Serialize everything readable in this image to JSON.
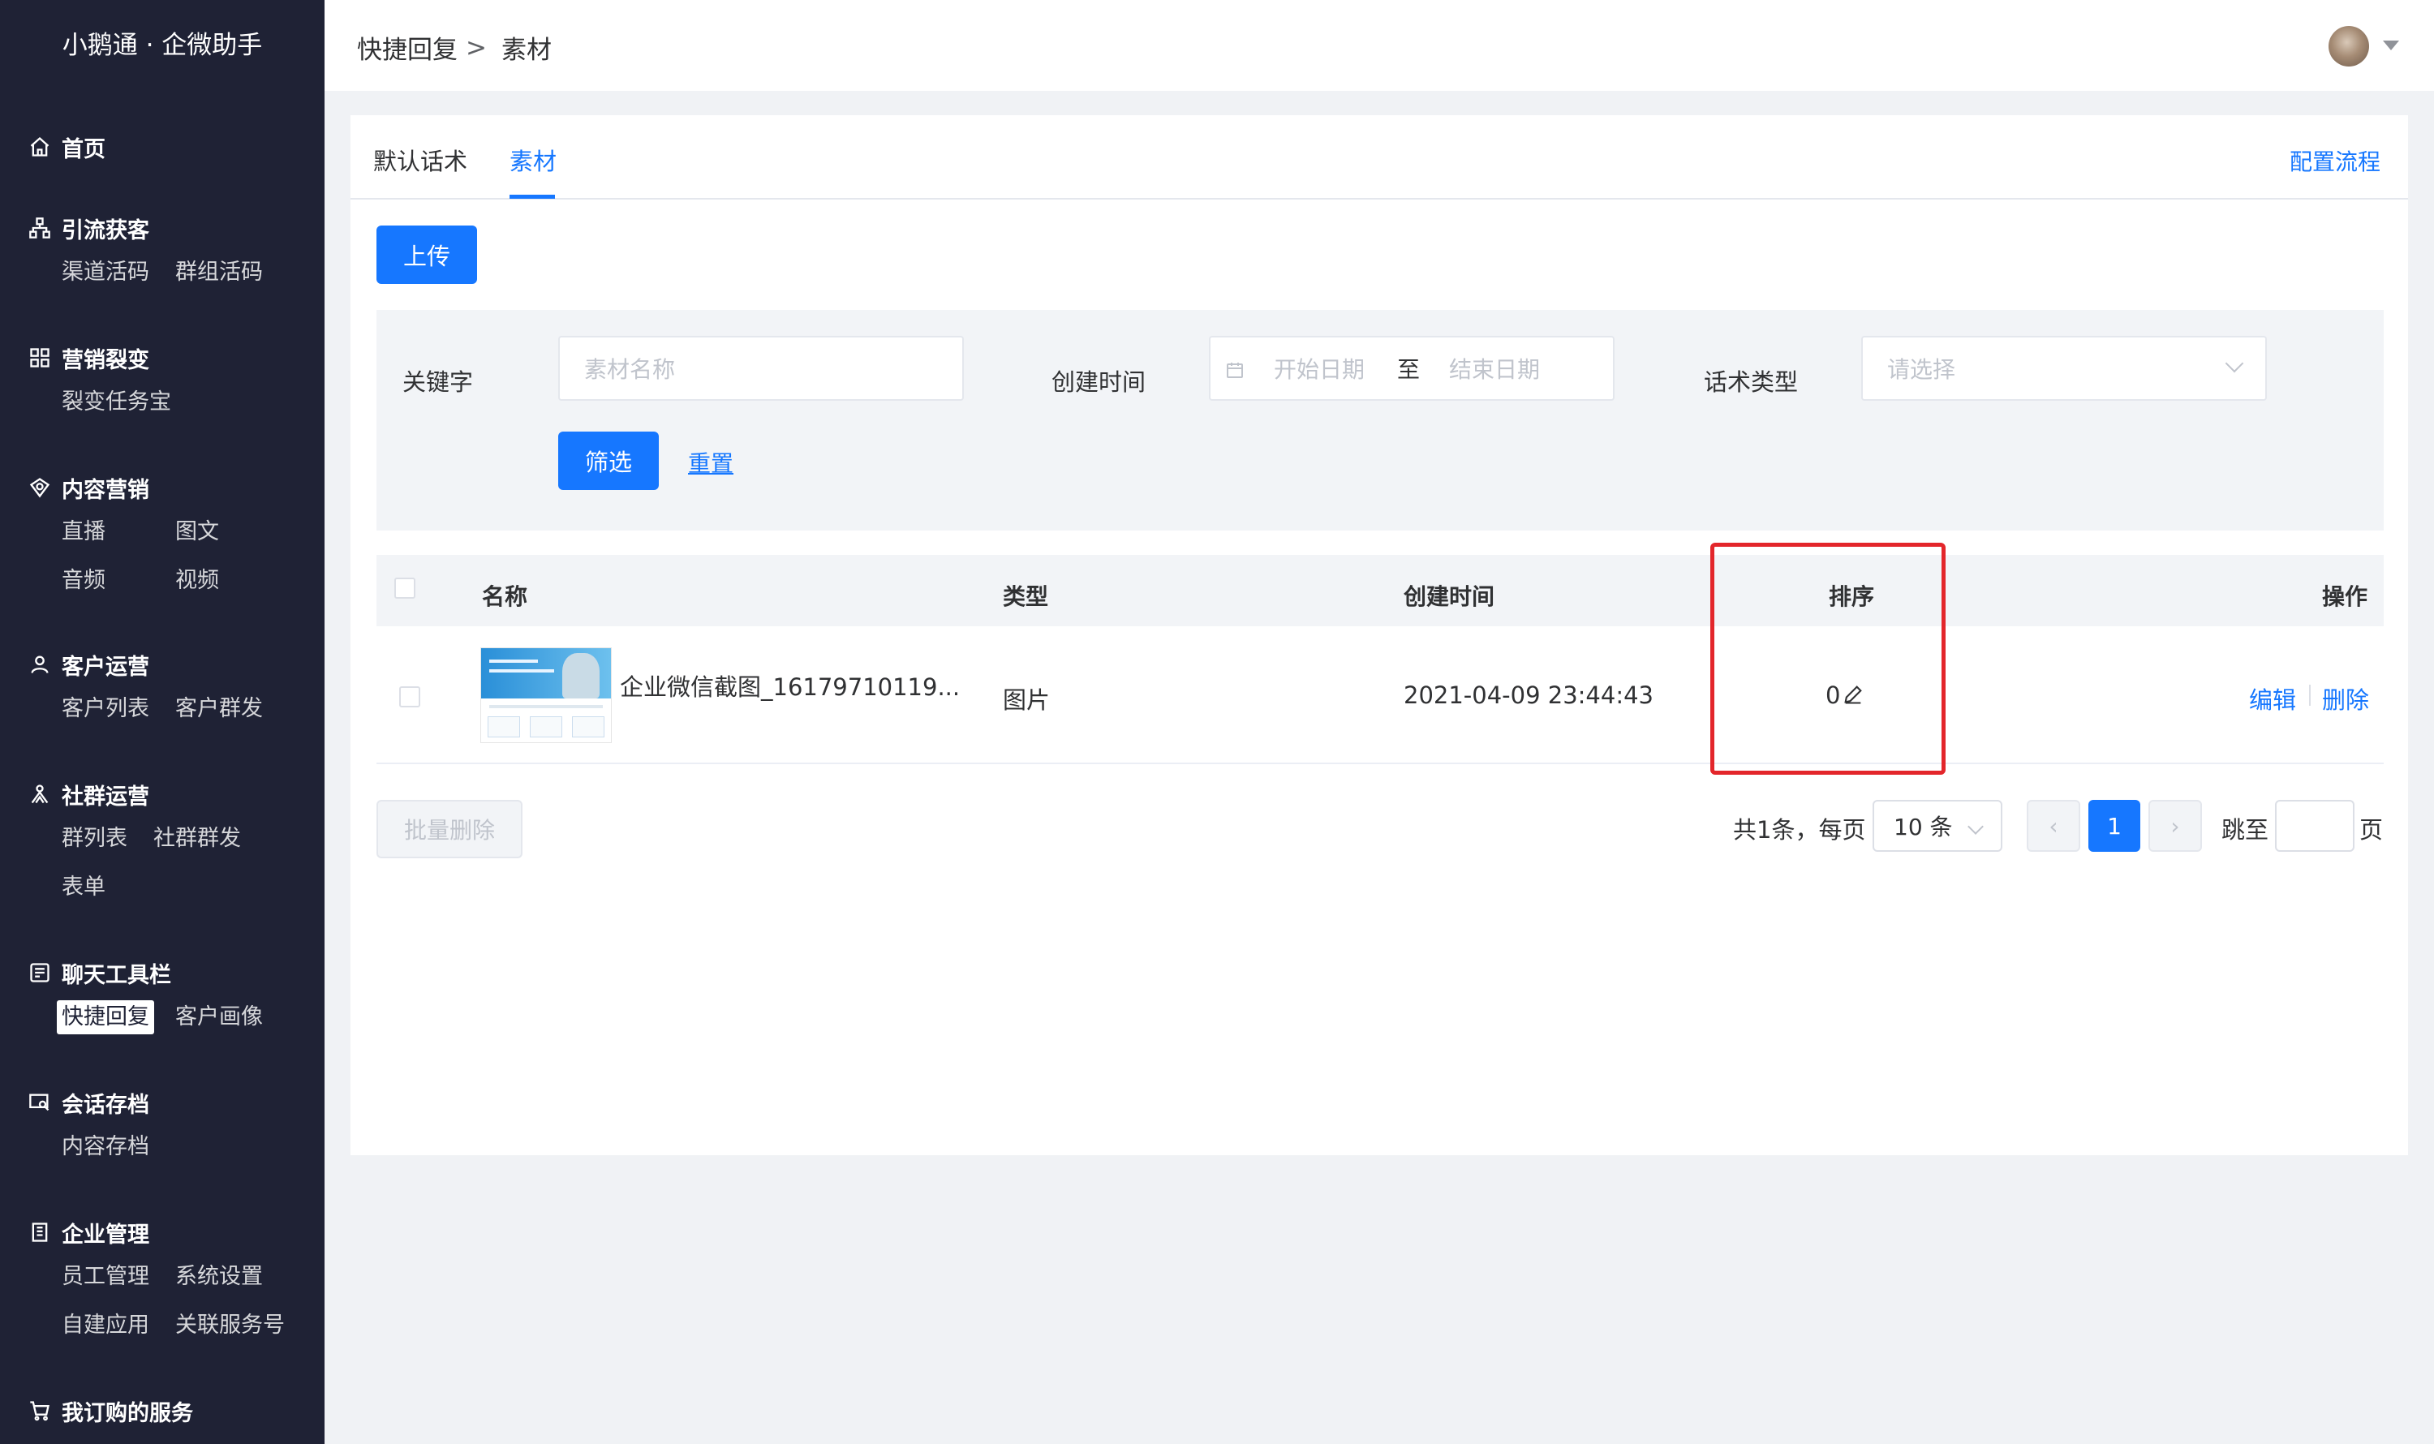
{
  "app": {
    "title": "小鹅通 · 企微助手"
  },
  "sidebar": {
    "groups": [
      {
        "label": "首页",
        "icon": "home-icon",
        "items": []
      },
      {
        "label": "引流获客",
        "icon": "org-chart-icon",
        "items": [
          "渠道活码",
          "群组活码"
        ]
      },
      {
        "label": "营销裂变",
        "icon": "network-icon",
        "items": [
          "裂变任务宝"
        ]
      },
      {
        "label": "内容营销",
        "icon": "target-icon",
        "items": [
          "直播",
          "图文",
          "音频",
          "视频"
        ]
      },
      {
        "label": "客户运营",
        "icon": "user-icon",
        "items": [
          "客户列表",
          "客户群发"
        ]
      },
      {
        "label": "社群运营",
        "icon": "group-icon",
        "items": [
          "群列表",
          "社群群发",
          "表单"
        ]
      },
      {
        "label": "聊天工具栏",
        "icon": "chat-tool-icon",
        "items": [
          "快捷回复",
          "客户画像"
        ],
        "active": "快捷回复"
      },
      {
        "label": "会话存档",
        "icon": "archive-search-icon",
        "items": [
          "内容存档"
        ]
      },
      {
        "label": "企业管理",
        "icon": "building-icon",
        "items": [
          "员工管理",
          "系统设置",
          "自建应用",
          "关联服务号"
        ]
      },
      {
        "label": "我订购的服务",
        "icon": "cart-icon",
        "items": []
      }
    ]
  },
  "header": {
    "breadcrumb": [
      "快捷回复",
      "素材"
    ],
    "separator": ">"
  },
  "tabs": {
    "items": [
      "默认话术",
      "素材"
    ],
    "active": "素材",
    "config_link": "配置流程"
  },
  "toolbar": {
    "upload_label": "上传"
  },
  "filter": {
    "keyword_label": "关键字",
    "keyword_placeholder": "素材名称",
    "created_label": "创建时间",
    "start_placeholder": "开始日期",
    "range_separator": "至",
    "end_placeholder": "结束日期",
    "type_label": "话术类型",
    "type_placeholder": "请选择",
    "filter_button": "筛选",
    "reset_link": "重置"
  },
  "table": {
    "columns": [
      "名称",
      "类型",
      "创建时间",
      "排序",
      "操作"
    ],
    "rows": [
      {
        "name": "企业微信截图_16179710119...",
        "type": "图片",
        "created": "2021-04-09 23:44:43",
        "sort": "0",
        "actions": [
          "编辑",
          "删除"
        ]
      }
    ]
  },
  "footer": {
    "batch_delete": "批量删除",
    "total_text": "共1条，每页",
    "page_size": "10 条",
    "current_page": "1",
    "jump_label": "跳至",
    "page_unit": "页"
  },
  "colors": {
    "primary": "#1677ff",
    "sidebar_bg": "#1f2235",
    "highlight": "#e3262b"
  }
}
